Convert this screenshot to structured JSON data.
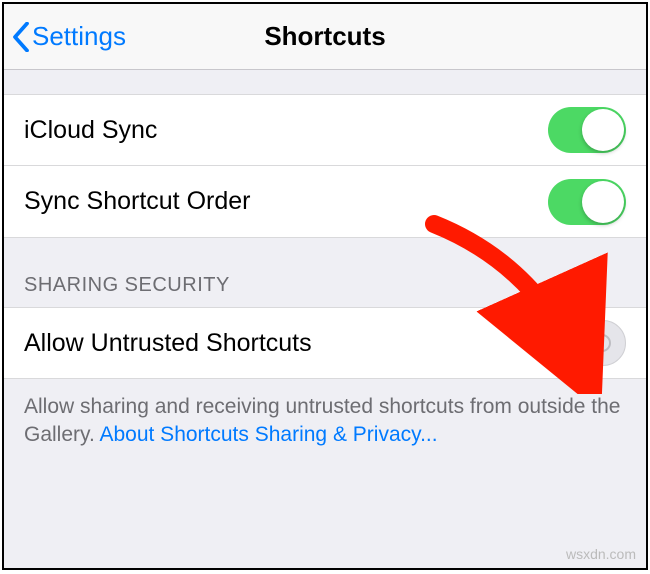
{
  "nav": {
    "back_label": "Settings",
    "title": "Shortcuts"
  },
  "cells": {
    "icloud_sync": {
      "label": "iCloud Sync",
      "on": true
    },
    "sync_order": {
      "label": "Sync Shortcut Order",
      "on": true
    },
    "allow_untrusted": {
      "label": "Allow Untrusted Shortcuts",
      "on": false
    }
  },
  "section": {
    "sharing_security": "SHARING SECURITY"
  },
  "footer": {
    "text": "Allow sharing and receiving untrusted shortcuts from outside the Gallery. ",
    "link": "About Shortcuts Sharing & Privacy..."
  },
  "watermark": "wsxdn.com"
}
